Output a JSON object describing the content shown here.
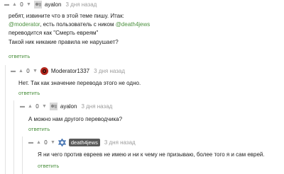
{
  "comments": [
    {
      "vote_count": "0",
      "author": "ayalon",
      "time": "3 дня назад",
      "line1": "ребят, извините что в этой теме пишу. Итак:",
      "line2_mention1": "@moderator",
      "line2_mid": ", есть пользователь с ником ",
      "line2_mention2": "@death4jews",
      "line3": "переводится как \"Смерть евреям\"",
      "line4": "Такой ник никакие правила не нарушает?",
      "reply": "ответить"
    },
    {
      "vote_count": "0",
      "author": "Moderator1337",
      "time": "3 дня назад",
      "text": "Нет. Так как значение перевода этого не одно.",
      "reply": "ответить"
    },
    {
      "vote_count": "0",
      "author": "ayalon",
      "time": "3 дня назад",
      "text": "А можно нам другого переводчика?",
      "reply": "ответить"
    },
    {
      "vote_count": "0",
      "author": "death4jews",
      "time": "3 дня назад",
      "text": "Я ни чего против евреев не имею и ни к чему не призываю, более того я и сам еврей.",
      "reply": "ответить"
    }
  ]
}
